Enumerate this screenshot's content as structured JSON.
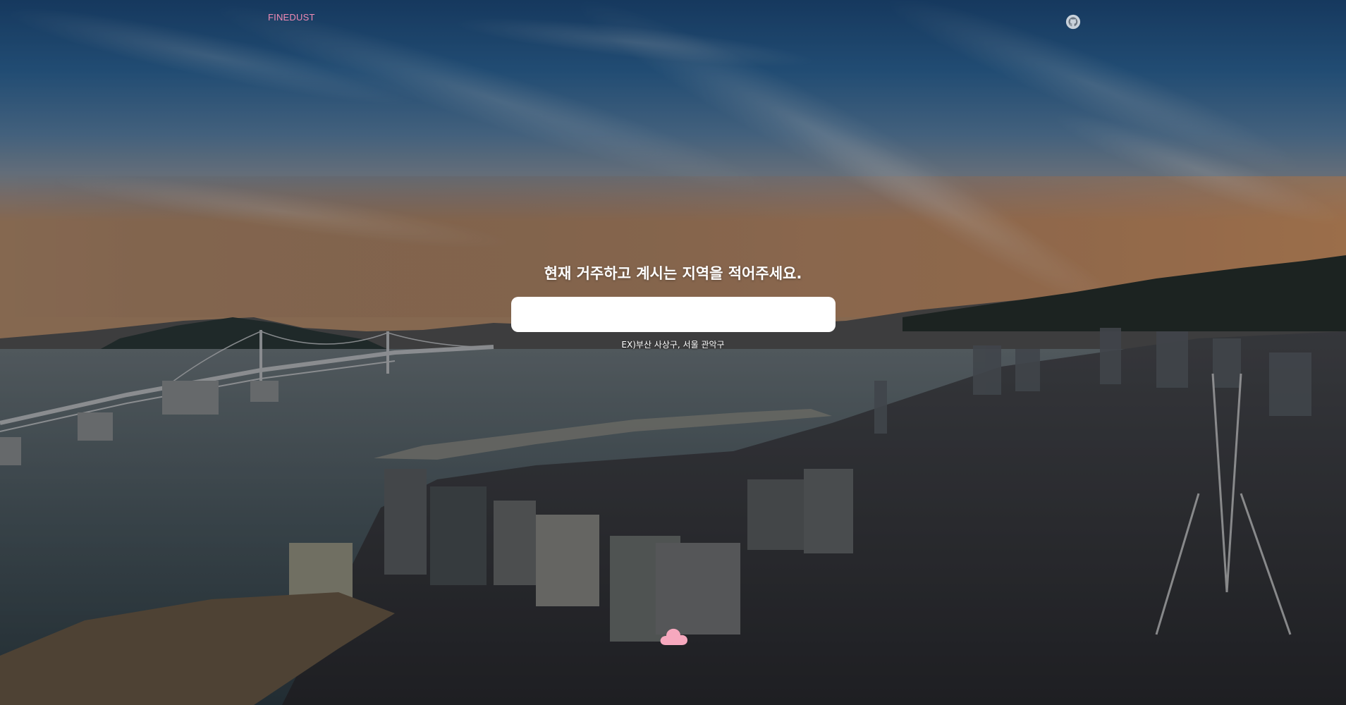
{
  "header": {
    "brand": "FINEDUST",
    "github_icon": "github-icon",
    "brand_color": "#f08ab4"
  },
  "main": {
    "prompt": "현재 거주하고 계시는 지역을 적어주세요.",
    "search_value": "",
    "hint": "EX)부산 사상구, 서울 관악구"
  },
  "footer": {
    "cloud_icon": "cloud-icon",
    "cloud_color": "#f6a8be"
  }
}
